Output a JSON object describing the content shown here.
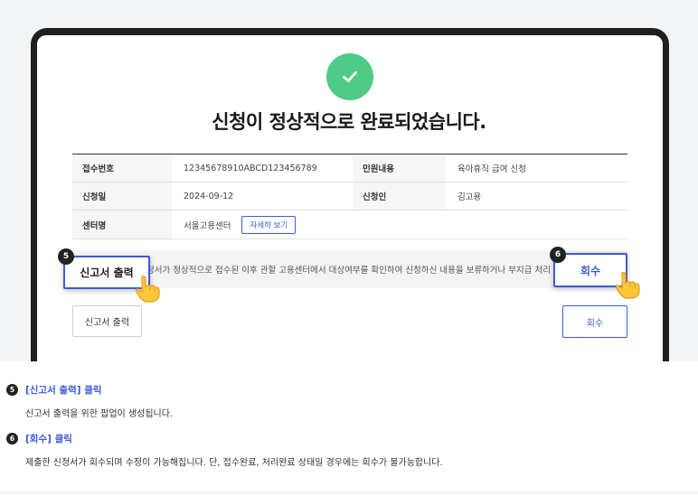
{
  "completion": {
    "title": "신청이 정상적으로 완료되었습니다."
  },
  "info": {
    "receipt_label": "접수번호",
    "receipt_value": "12345678910ABCD123456789",
    "request_type_label": "민원내용",
    "request_type_value": "육아휴직 급여 신청",
    "date_label": "신청일",
    "date_value": "2024-09-12",
    "applicant_label": "신청인",
    "applicant_value": "김고용",
    "center_label": "센터명",
    "center_value": "서울고용센터",
    "detail_button": "자세히 보기"
  },
  "notice_text": "정서가 정상적으로 접수된 이후 관할 고용센터에서 대상여부를 확인하여 신청하신 내용을 보류하거나 부지급 처리",
  "buttons": {
    "print_label": "신고서 출력",
    "withdraw_label": "회수"
  },
  "callouts": {
    "print_badge": "5",
    "withdraw_badge": "6"
  },
  "steps": [
    {
      "number": "5",
      "title": "[신고서 출력] 클릭",
      "description": "신고서 출력을 위한 팝업이 생성됩니다."
    },
    {
      "number": "6",
      "title": "[회수] 클릭",
      "description": "제출한 신청서가 회수되며 수정이 가능해집니다. 단, 접수완료, 처리완료 상태일 경우에는 회수가 불가능합니다."
    }
  ],
  "colors": {
    "accent": "#3d5bd9",
    "success": "#4ecb84",
    "frame": "#1f1f1f"
  },
  "icons": {
    "success": "check-circle-icon",
    "pointer": "hand-pointer-icon"
  }
}
